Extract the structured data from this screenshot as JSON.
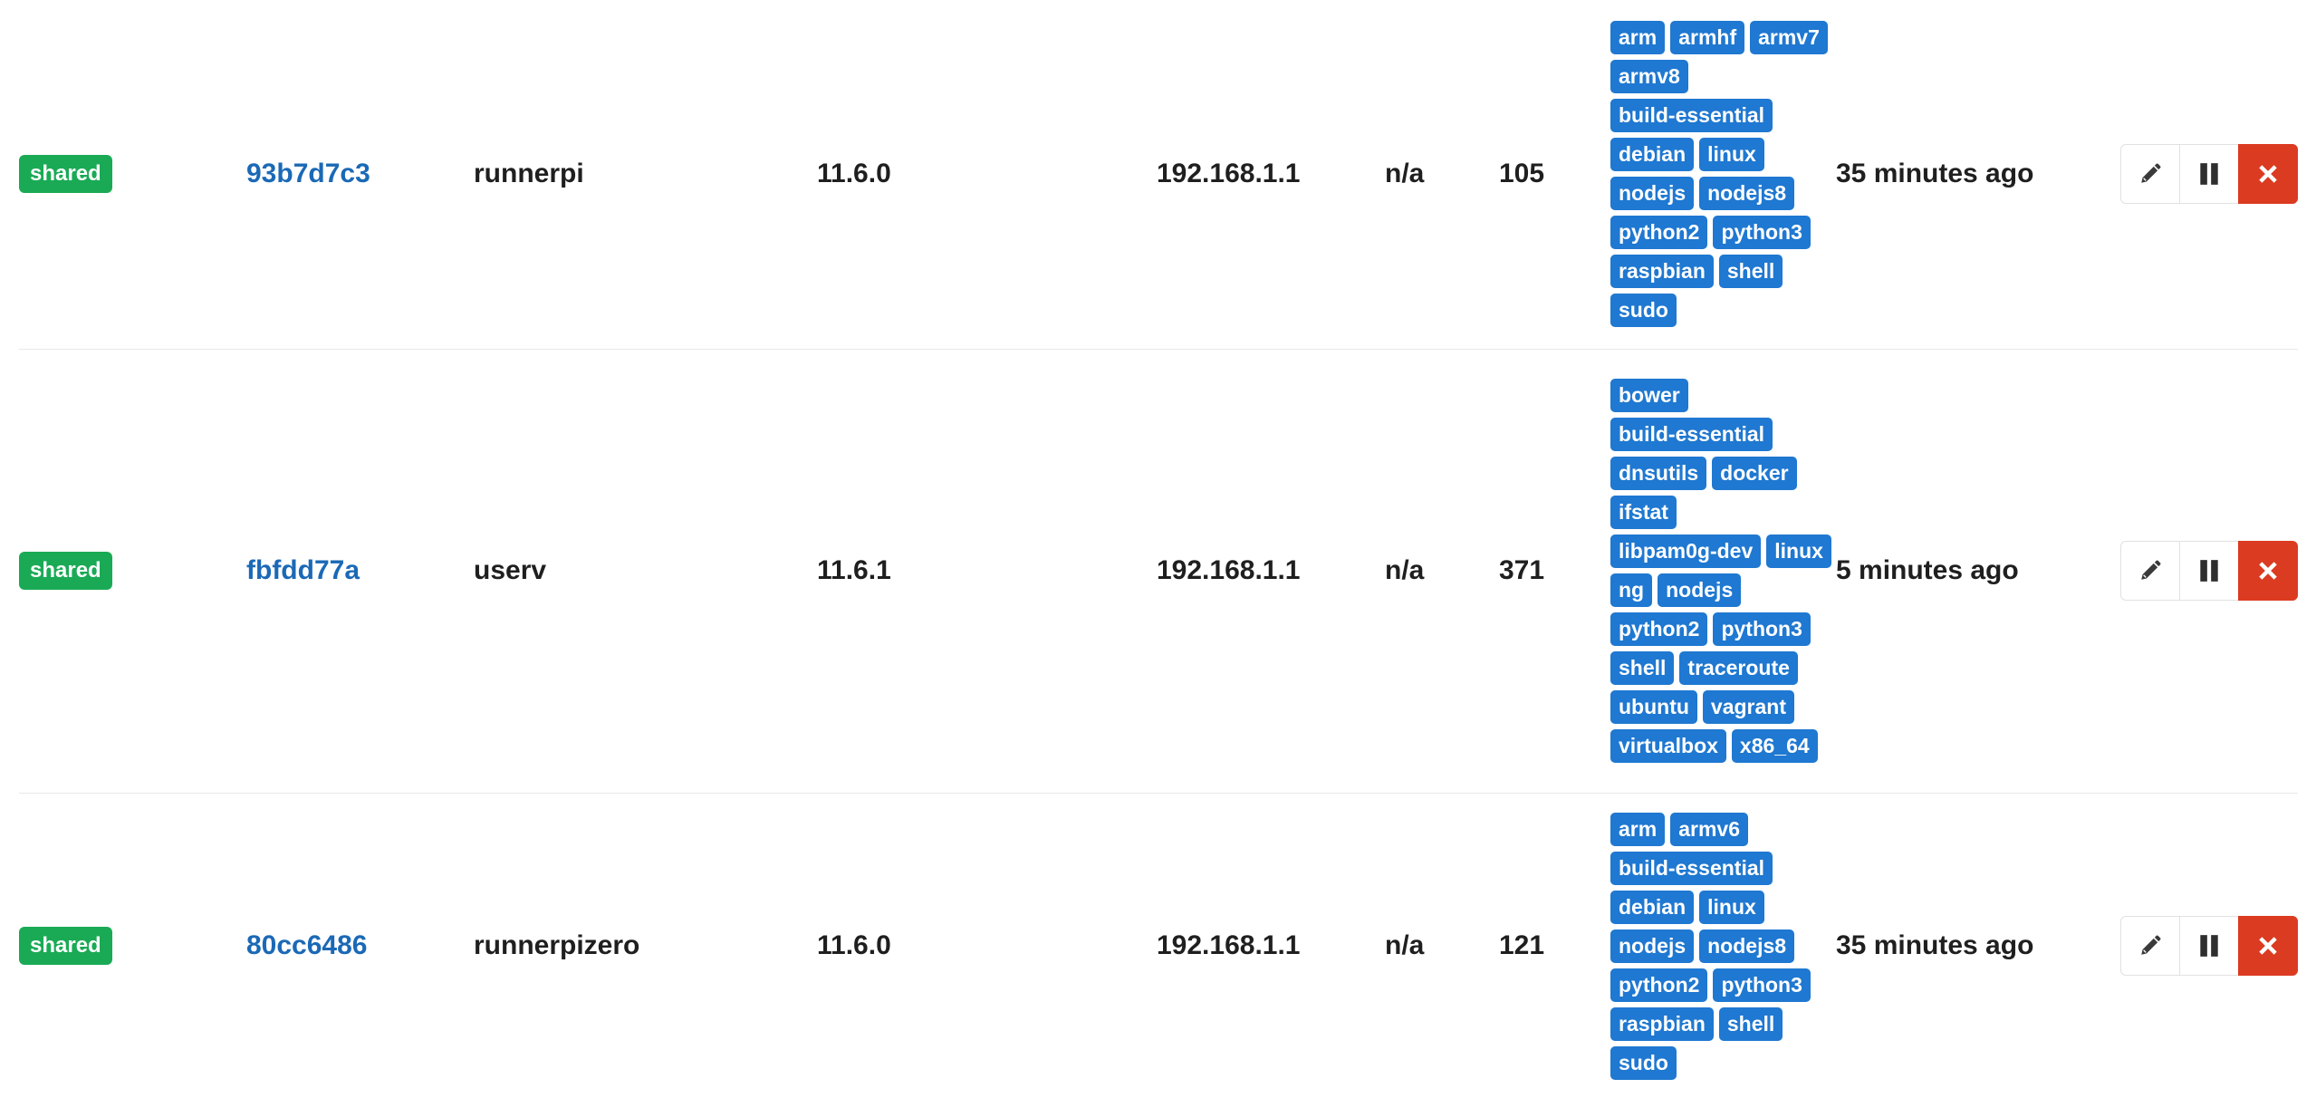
{
  "runners": [
    {
      "type": "shared",
      "id": "93b7d7c3",
      "description": "runnerpi",
      "version": "11.6.0",
      "ip": "192.168.1.1",
      "projects": "n/a",
      "jobs": "105",
      "tag_lines": [
        [
          "arm",
          "armhf",
          "armv7"
        ],
        [
          "armv8"
        ],
        [
          "build-essential"
        ],
        [
          "debian",
          "linux"
        ],
        [
          "nodejs",
          "nodejs8"
        ],
        [
          "python2",
          "python3"
        ],
        [
          "raspbian",
          "shell"
        ],
        [
          "sudo"
        ]
      ],
      "last_contact": "35 minutes ago"
    },
    {
      "type": "shared",
      "id": "fbfdd77a",
      "description": "userv",
      "version": "11.6.1",
      "ip": "192.168.1.1",
      "projects": "n/a",
      "jobs": "371",
      "tag_lines": [
        [
          "bower"
        ],
        [
          "build-essential"
        ],
        [
          "dnsutils",
          "docker"
        ],
        [
          "ifstat"
        ],
        [
          "libpam0g-dev",
          "linux"
        ],
        [
          "ng",
          "nodejs"
        ],
        [
          "python2",
          "python3"
        ],
        [
          "shell",
          "traceroute"
        ],
        [
          "ubuntu",
          "vagrant"
        ],
        [
          "virtualbox",
          "x86_64"
        ]
      ],
      "last_contact": "5 minutes ago"
    },
    {
      "type": "shared",
      "id": "80cc6486",
      "description": "runnerpizero",
      "version": "11.6.0",
      "ip": "192.168.1.1",
      "projects": "n/a",
      "jobs": "121",
      "tag_lines": [
        [
          "arm",
          "armv6"
        ],
        [
          "build-essential"
        ],
        [
          "debian",
          "linux"
        ],
        [
          "nodejs",
          "nodejs8"
        ],
        [
          "python2",
          "python3"
        ],
        [
          "raspbian",
          "shell"
        ],
        [
          "sudo"
        ]
      ],
      "last_contact": "35 minutes ago"
    }
  ],
  "actions": {
    "edit_icon": "pencil-icon",
    "pause_icon": "pause-icon",
    "remove_icon": "close-icon"
  },
  "colors": {
    "shared_badge": "#1aaa55",
    "tag": "#1f78d1",
    "link": "#1b69b6",
    "remove_button": "#db3b21"
  }
}
